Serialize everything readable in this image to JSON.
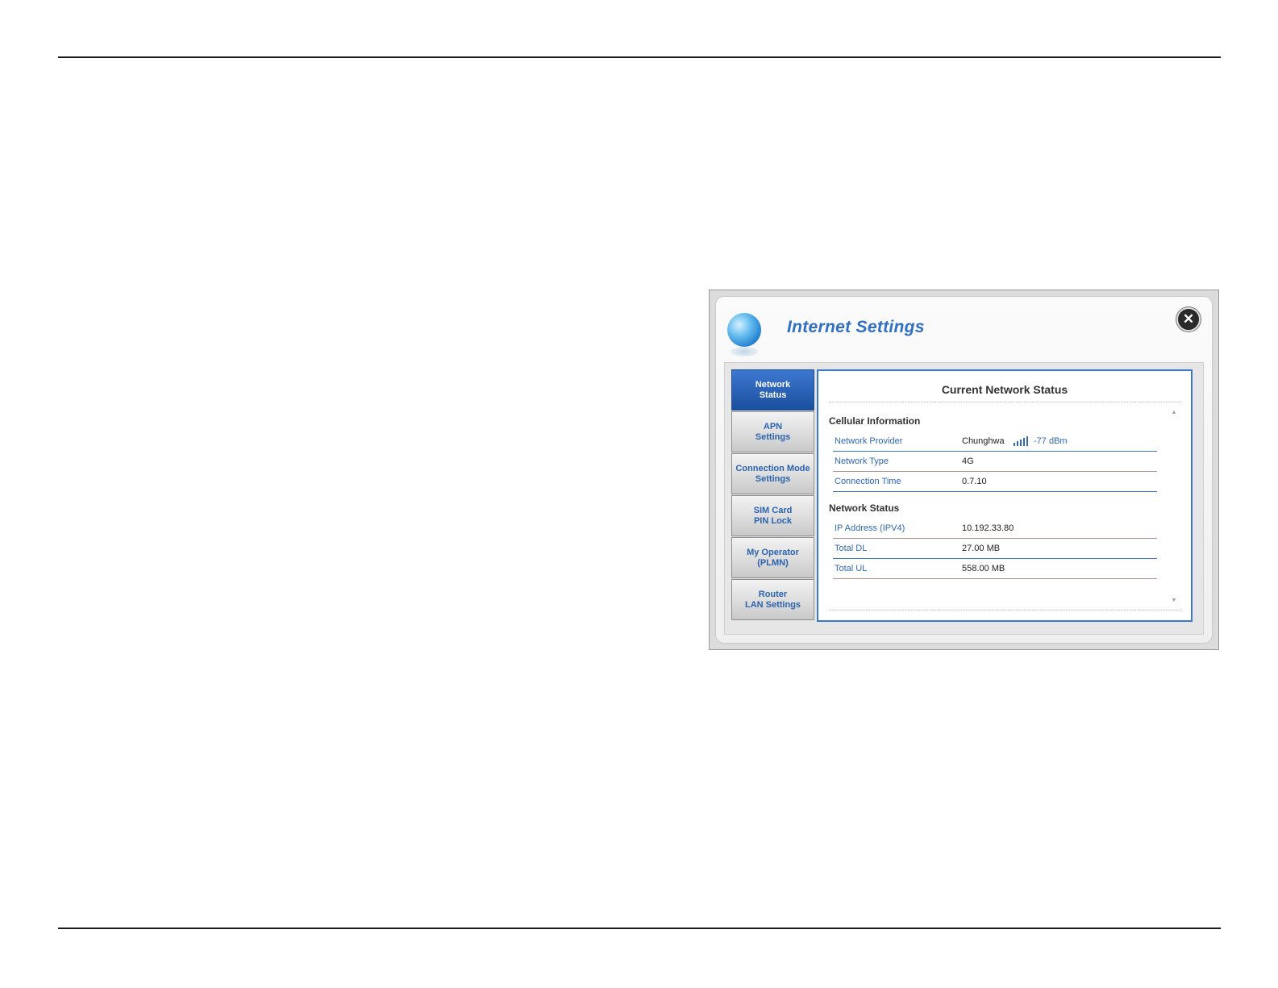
{
  "dialog": {
    "title": "Internet Settings",
    "close_label": "✕"
  },
  "tabs": [
    {
      "line1": "Network",
      "line2": "Status",
      "active": true
    },
    {
      "line1": "APN",
      "line2": "Settings",
      "active": false
    },
    {
      "line1": "Connection Mode",
      "line2": "Settings",
      "active": false
    },
    {
      "line1": "SIM Card",
      "line2": "PIN Lock",
      "active": false
    },
    {
      "line1": "My Operator",
      "line2": "(PLMN)",
      "active": false
    },
    {
      "line1": "Router",
      "line2": "LAN Settings",
      "active": false
    }
  ],
  "panel": {
    "title": "Current Network Status",
    "cellular": {
      "heading": "Cellular Information",
      "provider_label": "Network Provider",
      "provider_value": "Chunghwa",
      "signal_dbm": "-77 dBm",
      "type_label": "Network Type",
      "type_value": "4G",
      "time_label": "Connection Time",
      "time_value": "0.7.10"
    },
    "network": {
      "heading": "Network Status",
      "ip_label": "IP Address (IPV4)",
      "ip_value": "10.192.33.80",
      "dl_label": "Total DL",
      "dl_value": "27.00 MB",
      "ul_label": "Total UL",
      "ul_value": "558.00 MB"
    }
  },
  "colors": {
    "accent_blue": "#2f6fc4",
    "active_tab": "#1b4f9f",
    "panel_border": "#3a78c9"
  },
  "icons": [
    "globe-icon",
    "close-icon",
    "signal-strength-icon"
  ]
}
